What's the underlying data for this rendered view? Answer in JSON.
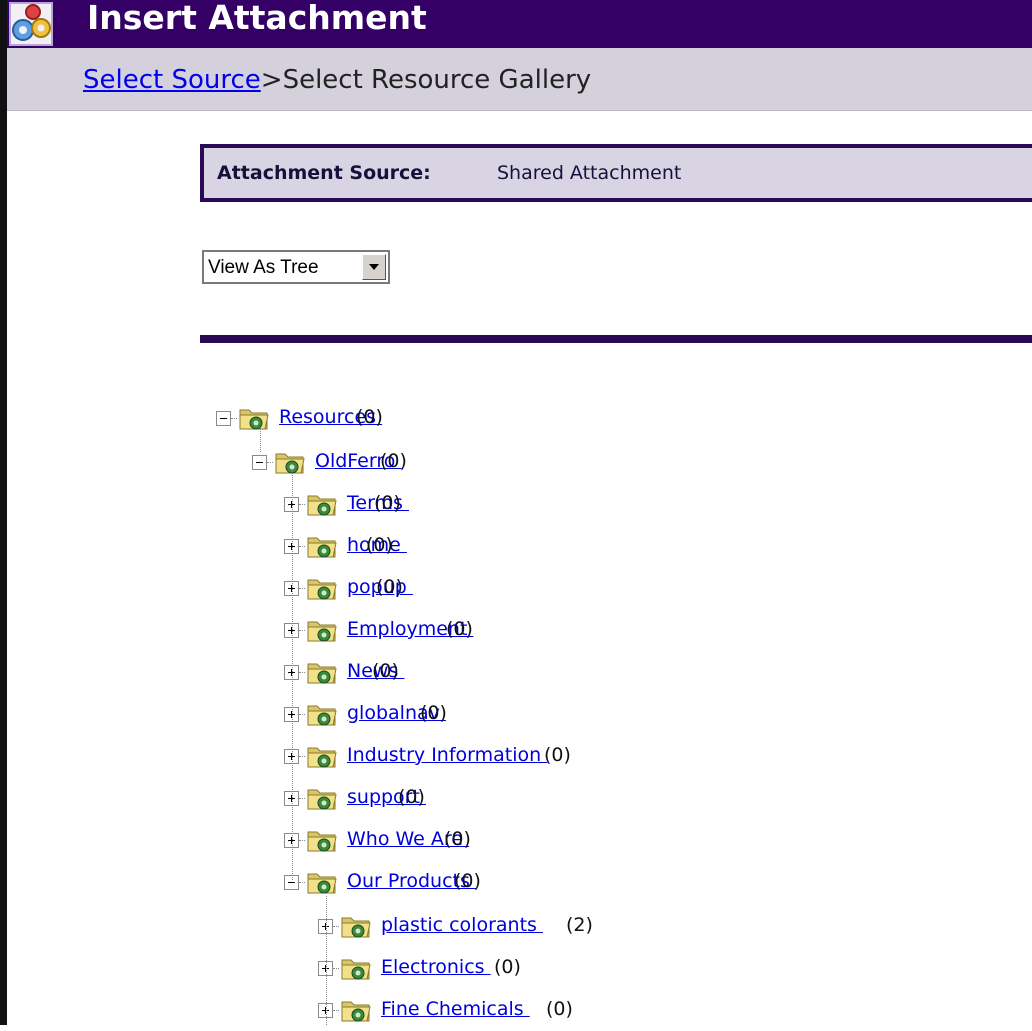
{
  "window": {
    "title": "Insert Attachment"
  },
  "breadcrumb": {
    "link": "Select Source",
    "separator": ">",
    "current": "Select Resource Gallery"
  },
  "source": {
    "label": "Attachment Source:",
    "value": "Shared Attachment"
  },
  "view_select": {
    "selected": "View As Tree"
  },
  "tree": [
    {
      "label": "Resources",
      "count": "(0)",
      "expanded": true
    },
    {
      "label": "OldFerro",
      "count": "(0)",
      "expanded": true
    },
    {
      "label": "Terms",
      "count": "(0)",
      "expanded": false
    },
    {
      "label": "home",
      "count": "(0)",
      "expanded": false
    },
    {
      "label": "popup",
      "count": "(0)",
      "expanded": false
    },
    {
      "label": "Employment",
      "count": "(0)",
      "expanded": false
    },
    {
      "label": "News",
      "count": "(0)",
      "expanded": false
    },
    {
      "label": "globalnav",
      "count": "(0)",
      "expanded": false
    },
    {
      "label": "Industry Information",
      "count": "(0)",
      "expanded": false
    },
    {
      "label": "support",
      "count": "(0)",
      "expanded": false
    },
    {
      "label": "Who We Are",
      "count": "(0)",
      "expanded": false
    },
    {
      "label": "Our Products",
      "count": "(0)",
      "expanded": true
    },
    {
      "label": "plastic colorants",
      "count": "(2)",
      "expanded": false
    },
    {
      "label": "Electronics",
      "count": "(0)",
      "expanded": false
    },
    {
      "label": "Fine Chemicals",
      "count": "(0)",
      "expanded": false
    }
  ],
  "icons": {
    "folder": "folder-resource-icon",
    "app": "app-gears-icon",
    "dropdown": "dropdown-arrow-icon"
  }
}
